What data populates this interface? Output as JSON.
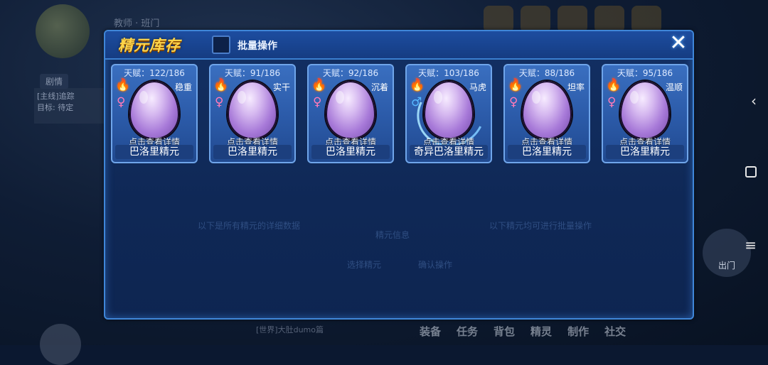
{
  "background": {
    "player_name": "教师 · 班门",
    "tag": "剧情",
    "quest_lines": [
      "[主线]追踪",
      "目标: 待定"
    ],
    "chat_text": "[世界]大肚dumo篇",
    "bottom_menu": [
      "装备",
      "任务",
      "背包",
      "精灵",
      "制作",
      "社交"
    ],
    "exit_label": "出门",
    "ghost_texts": [
      "以下是所有精元的详细数据",
      "精元信息",
      "以下精元均可进行批量操作",
      "选择精元",
      "确认操作"
    ]
  },
  "panel": {
    "title": "精元库存",
    "batch_label": "批量操作",
    "close_icon": "close-icon"
  },
  "cards": [
    {
      "talent": "天赋：122/186",
      "nature": "稳重",
      "gender": "♀",
      "gender_type": "female",
      "hint": "点击查看详情",
      "name": "巴洛里精元",
      "strange": false
    },
    {
      "talent": "天赋：91/186",
      "nature": "实干",
      "gender": "♀",
      "gender_type": "female",
      "hint": "点击查看详情",
      "name": "巴洛里精元",
      "strange": false
    },
    {
      "talent": "天赋：92/186",
      "nature": "沉着",
      "gender": "♀",
      "gender_type": "female",
      "hint": "点击查看详情",
      "name": "巴洛里精元",
      "strange": false
    },
    {
      "talent": "天赋：103/186",
      "nature": "马虎",
      "gender": "♂",
      "gender_type": "male",
      "hint": "点击查看详情",
      "name": "奇异巴洛里精元",
      "strange": true
    },
    {
      "talent": "天赋：88/186",
      "nature": "坦率",
      "gender": "♀",
      "gender_type": "female",
      "hint": "点击查看详情",
      "name": "巴洛里精元",
      "strange": false
    },
    {
      "talent": "天赋：95/186",
      "nature": "温顺",
      "gender": "♀",
      "gender_type": "female",
      "hint": "点击查看详情",
      "name": "巴洛里精元",
      "strange": false
    }
  ],
  "colors": {
    "title": "#ffd54a",
    "panel_border": "#3f86d8",
    "female": "#ff7ab8",
    "male": "#57b8ff"
  }
}
